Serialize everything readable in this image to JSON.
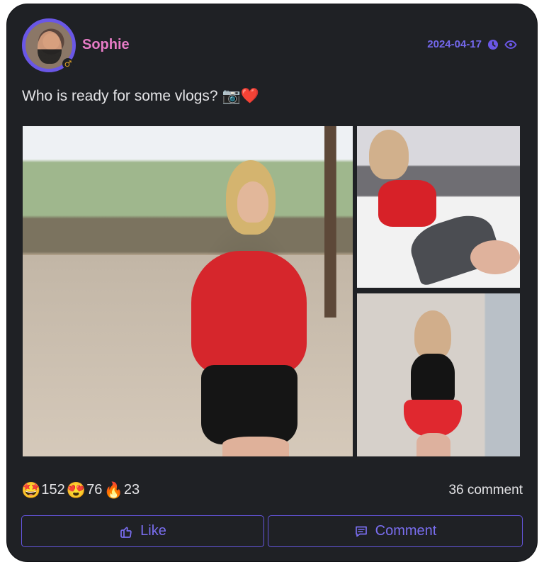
{
  "post": {
    "username": "Sophie",
    "date": "2024-04-17",
    "text": "Who is ready for some vlogs? 📷❤️",
    "reactions": [
      {
        "emoji": "🤩",
        "count": "152"
      },
      {
        "emoji": "😍",
        "count": "76"
      },
      {
        "emoji": "🔥",
        "count": "23"
      }
    ],
    "comment_count": "36 comment"
  },
  "actions": {
    "like_label": "Like",
    "comment_label": "Comment"
  },
  "icons": {
    "clock": "clock-icon",
    "view": "eye-icon",
    "like": "thumbs-up-icon",
    "comment": "comment-icon",
    "badge": "gender-badge-icon"
  },
  "colors": {
    "card_bg": "#1f2125",
    "accent": "#6a57e6",
    "username": "#e77bc6",
    "text": "#e4e4e7"
  }
}
